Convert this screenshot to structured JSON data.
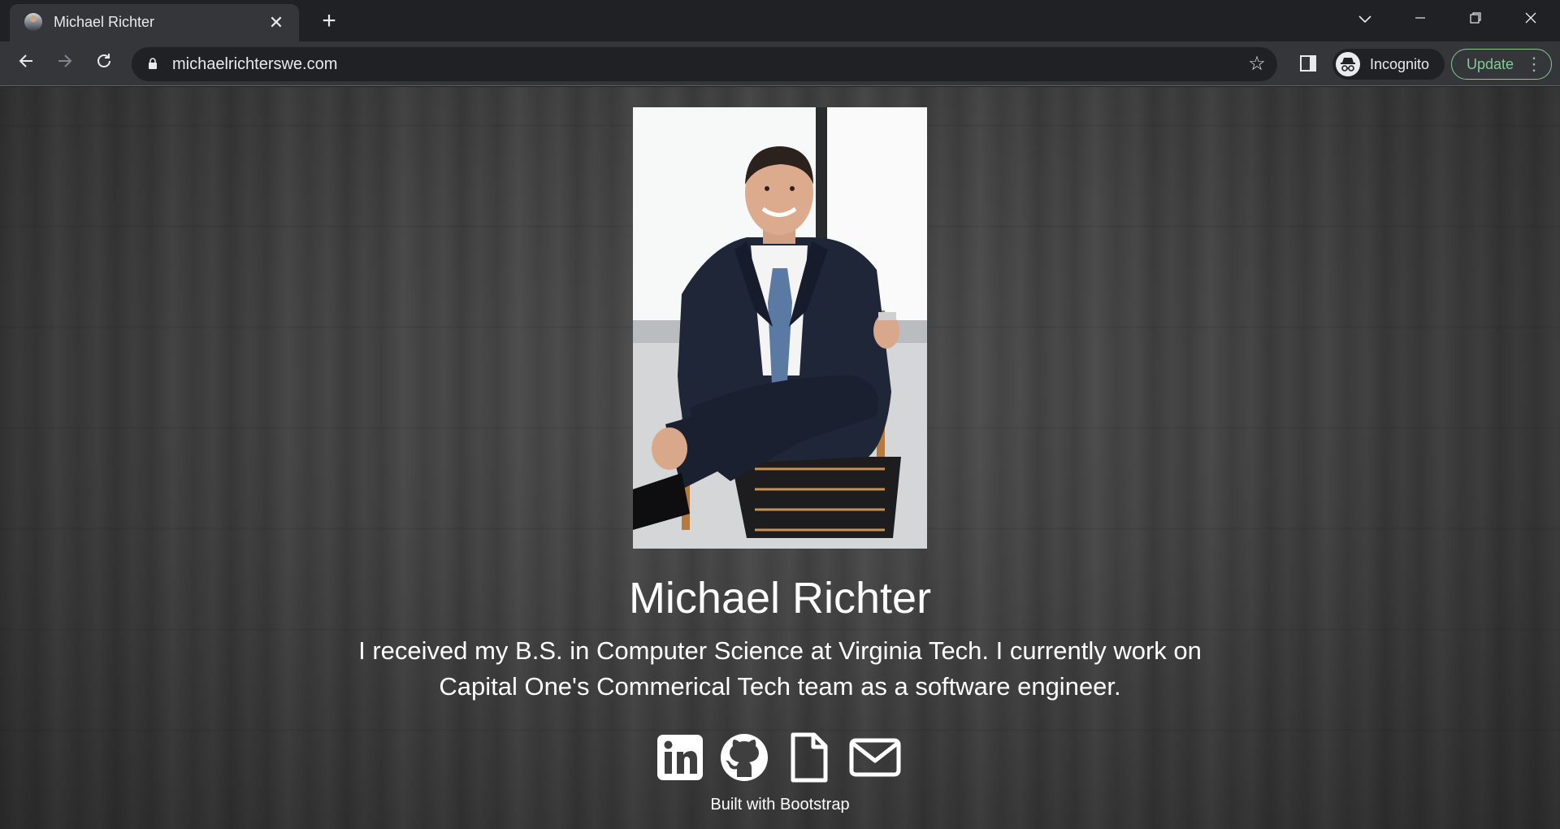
{
  "browser": {
    "tab_title": "Michael Richter",
    "url": "michaelrichterswe.com",
    "incognito_label": "Incognito",
    "update_label": "Update"
  },
  "page": {
    "name": "Michael Richter",
    "bio": "I received my B.S. in Computer Science at Virginia Tech. I currently work on Capital One's Commerical Tech team as a software engineer.",
    "footer": "Built with Bootstrap",
    "social_links": [
      "linkedin-icon",
      "github-icon",
      "resume-file-icon",
      "email-icon"
    ]
  },
  "colors": {
    "chrome_dark": "#202124",
    "chrome_toolbar": "#35363a",
    "update_accent": "#81c995",
    "text_white": "#ffffff"
  }
}
